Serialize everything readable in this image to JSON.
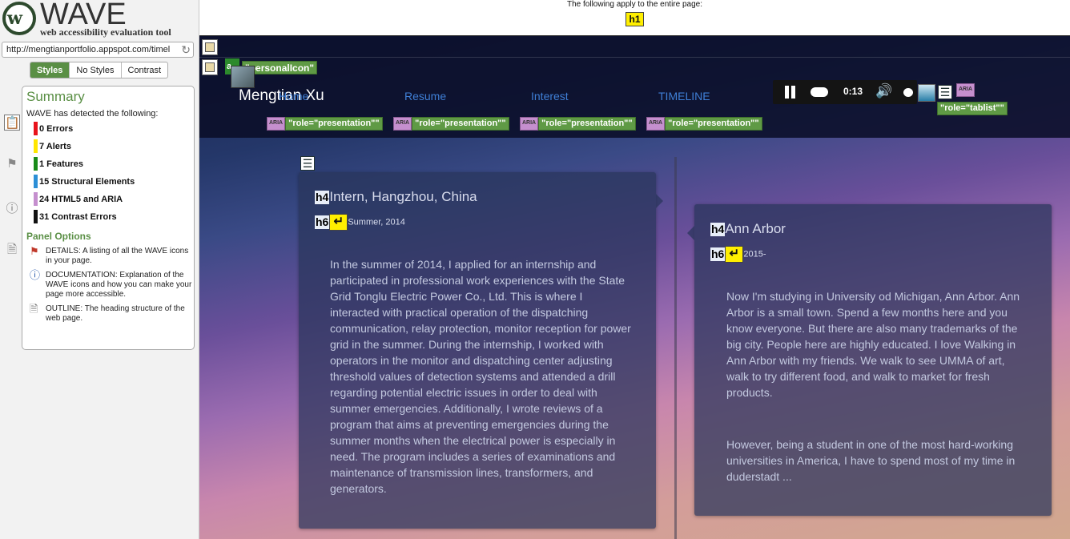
{
  "wave": {
    "logo_name": "WAVE",
    "logo_tagline": "web accessibility evaluation tool",
    "url": "http://mengtianportfolio.appspot.com/timel",
    "view_tabs": [
      "Styles",
      "No Styles",
      "Contrast"
    ],
    "side_icons": [
      "clipboard-icon",
      "flag-icon",
      "info-icon",
      "document-icon"
    ],
    "summary": {
      "title": "Summary",
      "detected_label": "WAVE has detected the following:",
      "items": [
        {
          "label": "0 Errors",
          "color": "#e8131b"
        },
        {
          "label": "7 Alerts",
          "color": "#ffe600"
        },
        {
          "label": "1 Features",
          "color": "#188a18"
        },
        {
          "label": "15 Structural Elements",
          "color": "#2c8fd6"
        },
        {
          "label": "24 HTML5 and ARIA",
          "color": "#c58fce"
        },
        {
          "label": "31 Contrast Errors",
          "color": "#111111"
        }
      ],
      "panel_options_title": "Panel Options",
      "options": [
        {
          "text": "DETAILS: A listing of all the WAVE icons in your page.",
          "icon": "flag-icon"
        },
        {
          "text": "DOCUMENTATION: Explanation of the WAVE icons and how you can make your page more accessible.",
          "icon": "info-icon"
        },
        {
          "text": "OUTLINE: The heading structure of the web page.",
          "icon": "document-icon"
        }
      ]
    }
  },
  "page": {
    "notice": "The following apply to the entire page:",
    "page_badge": "h1",
    "brand": "Mengtian Xu",
    "nav_links": [
      "Home",
      "Resume",
      "Interest",
      "TIMELINE"
    ],
    "player_time": "0:13",
    "aria_tag": "ARIA",
    "aria_presentation": "\"role=\"presentation\"\"",
    "aria_tablist": "\"role=\"tablist\"\"",
    "personal_icon_label": "\"personalIcon\"",
    "cards": [
      {
        "heading_level": "h4",
        "title": "Intern, Hangzhou, China",
        "sub_level": "h6",
        "subtitle": "Summer, 2014",
        "paragraphs": [
          "In the summer of 2014, I applied for an internship and participated in professional work experiences with the State Grid Tonglu Electric Power Co., Ltd. This is where I interacted with practical operation of the dispatching communication, relay protection, monitor reception for power grid in the summer. During the internship, I worked with operators in the monitor and dispatching center adjusting threshold values of detection systems and attended a drill regarding potential electric issues in order to deal with summer emergencies. Additionally, I wrote reviews of a program that aims at preventing emergencies during the summer months when the electrical power is especially in need. The program includes a series of examinations and maintenance of transmission lines, transformers, and generators."
        ]
      },
      {
        "heading_level": "h4",
        "title": "Ann Arbor",
        "sub_level": "h6",
        "subtitle": "2015-",
        "paragraphs": [
          "Now I'm studying in University od Michigan, Ann Arbor. Ann Arbor is a small town. Spend a few months here and you know everyone. But there are also many trademarks of the big city. People here are highly educated. I love Walking in Ann Arbor with my friends. We walk to see UMMA of art, walk to try different food, and walk to market for fresh products.",
          "However, being a student in one of the most hard-working universities in America, I have to spend most of my time in duderstadt ..."
        ]
      }
    ]
  }
}
